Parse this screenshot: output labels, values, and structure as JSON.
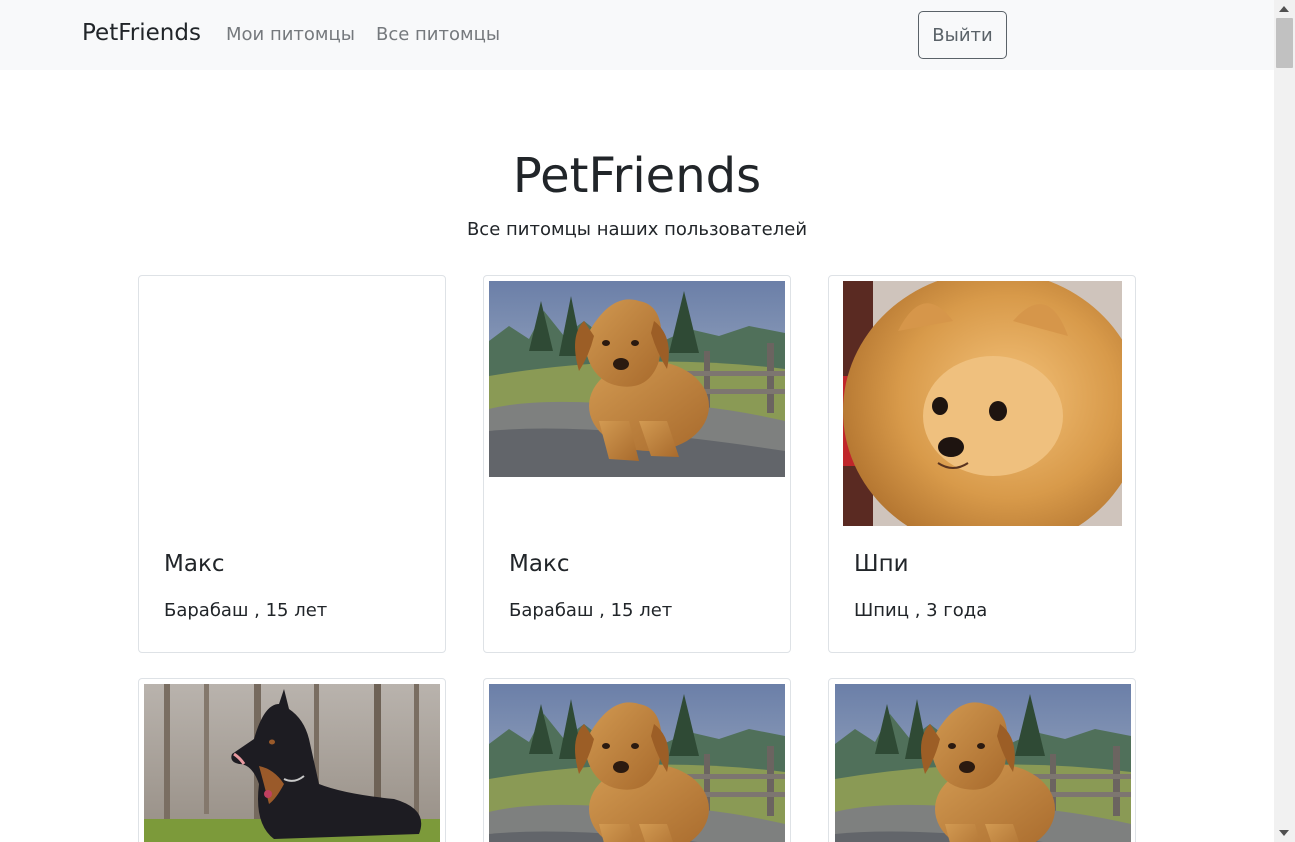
{
  "navbar": {
    "brand": "PetFriends",
    "links": [
      "Мои питомцы",
      "Все питомцы"
    ],
    "logout": "Выйти"
  },
  "header": {
    "title": "PetFriends",
    "subtitle": "Все питомцы наших пользователей"
  },
  "pets": [
    {
      "name": "Макс",
      "info": "Барабаш , 15 лет",
      "photo": "none"
    },
    {
      "name": "Макс",
      "info": "Барабаш , 15 лет",
      "photo": "golden-retriever-on-rock-photo"
    },
    {
      "name": "Шпи",
      "info": "Шпиц , 3 года",
      "photo": "pomeranian-photo"
    },
    {
      "photo": "doberman-photo"
    },
    {
      "photo": "golden-retriever-on-rock-photo"
    },
    {
      "photo": "golden-retriever-on-rock-photo"
    }
  ]
}
